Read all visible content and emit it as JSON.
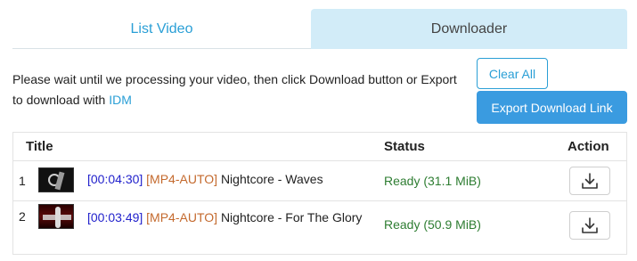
{
  "tabs": [
    {
      "label": "List Video",
      "active": false
    },
    {
      "label": "Downloader",
      "active": true
    }
  ],
  "info": {
    "text": "Please wait until we processing your video, then click Download button or Export to download with ",
    "link": "IDM"
  },
  "buttons": {
    "clear_all": "Clear All",
    "export": "Export Download Link"
  },
  "table": {
    "headers": {
      "title": "Title",
      "status": "Status",
      "action": "Action"
    },
    "rows": [
      {
        "num": "1",
        "duration": "[00:04:30]",
        "format": "[MP4-AUTO]",
        "title": "Nightcore - Waves",
        "status": "Ready (31.1 MiB)",
        "action_icon": "download-icon"
      },
      {
        "num": "2",
        "duration": "[00:03:49]",
        "format": "[MP4-AUTO]",
        "title": "Nightcore - For The Glory",
        "status": "Ready (50.9 MiB)",
        "action_icon": "download-icon"
      }
    ]
  },
  "colors": {
    "accent": "#2a9fd6",
    "active_tab_bg": "#d2ecf8",
    "export_button_bg": "#3a9be0",
    "status_ready": "#2e7d32",
    "duration_text": "#2222cc",
    "format_text": "#c46a2e"
  }
}
